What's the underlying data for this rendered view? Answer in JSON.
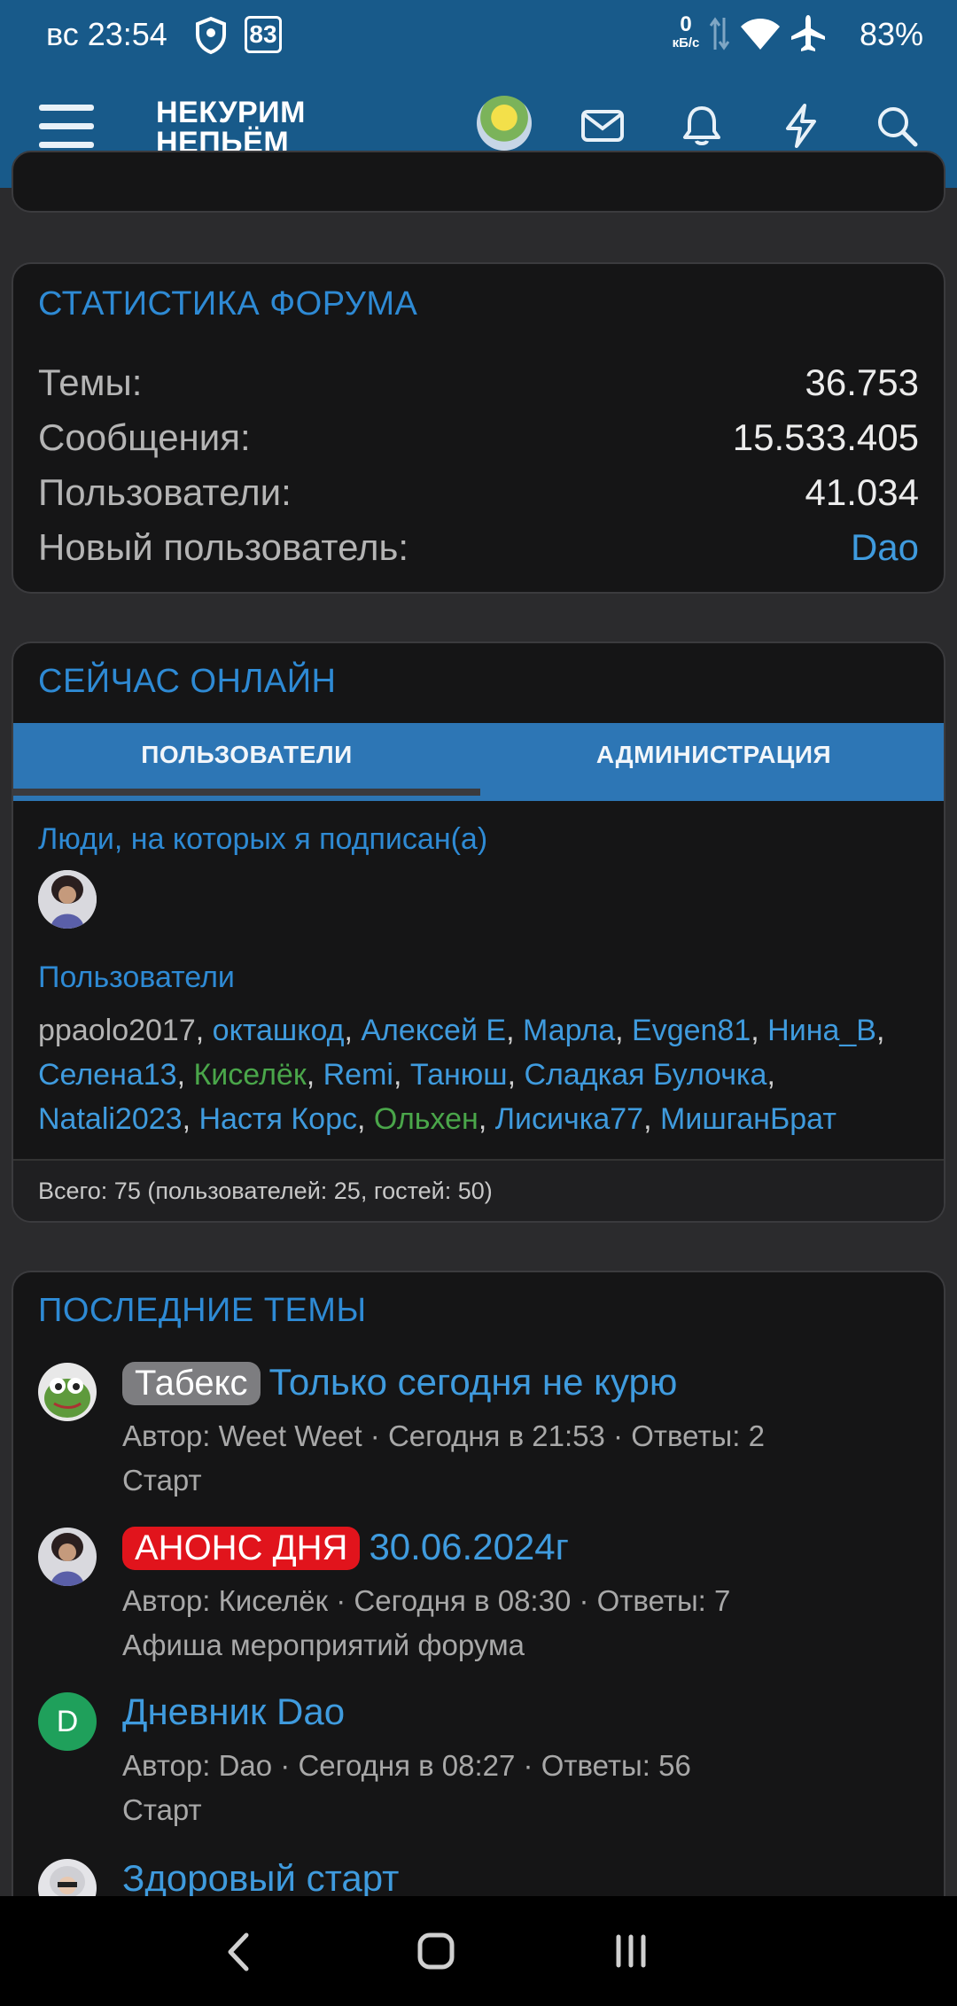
{
  "status_bar": {
    "time": "вс 23:54",
    "badge_number": "83",
    "net_speed_value": "0",
    "net_speed_unit": "кБ/с",
    "battery": "83%"
  },
  "app_bar": {
    "logo_line1": "НЕКУРИМ",
    "logo_line2": "НЕПЬЁМ"
  },
  "stats": {
    "title": "СТАТИСТИКА ФОРУМА",
    "rows": [
      {
        "label": "Темы:",
        "value": "36.753"
      },
      {
        "label": "Сообщения:",
        "value": "15.533.405"
      },
      {
        "label": "Пользователи:",
        "value": "41.034"
      },
      {
        "label": "Новый пользователь:",
        "value": "Dao"
      }
    ]
  },
  "online": {
    "title": "СЕЙЧАС ОНЛАЙН",
    "tabs": [
      "ПОЛЬЗОВАТЕЛИ",
      "АДМИНИСТРАЦИЯ"
    ],
    "following_heading": "Люди, на которых я подписан(а)",
    "users_heading": "Пользователи",
    "users": [
      {
        "name": "ppaolo2017",
        "color": "grey"
      },
      {
        "name": "окташкод",
        "color": "blue"
      },
      {
        "name": "Алексей Е",
        "color": "blue"
      },
      {
        "name": "Марла",
        "color": "blue"
      },
      {
        "name": "Evgen81",
        "color": "blue"
      },
      {
        "name": "Нина_В",
        "color": "blue"
      },
      {
        "name": "Селена13",
        "color": "blue"
      },
      {
        "name": "Киселёк",
        "color": "green"
      },
      {
        "name": "Remi",
        "color": "blue"
      },
      {
        "name": "Танюш",
        "color": "blue"
      },
      {
        "name": "Сладкая Булочка",
        "color": "blue"
      },
      {
        "name": "Natali2023",
        "color": "blue"
      },
      {
        "name": "Настя Корс",
        "color": "blue"
      },
      {
        "name": "Ольхен",
        "color": "green"
      },
      {
        "name": "Лисичка77",
        "color": "blue"
      },
      {
        "name": "МишганБрат",
        "color": "blue"
      }
    ],
    "total": "Всего: 75 (пользователей: 25, гостей: 50)"
  },
  "latest": {
    "title": "ПОСЛЕДНИЕ ТЕМЫ",
    "threads": [
      {
        "prefix": "Табекс",
        "prefix_color": "grey",
        "title": "Только сегодня не курю",
        "meta": "Автор: Weet Weet · Сегодня в 21:53 · Ответы: 2",
        "forum": "Старт"
      },
      {
        "prefix": "АНОНС ДНЯ",
        "prefix_color": "red",
        "title": "30.06.2024г",
        "meta": "Автор: Киселёк · Сегодня в 08:30 · Ответы: 7",
        "forum": "Афиша мероприятий форума"
      },
      {
        "prefix": "",
        "prefix_color": "",
        "title": "Дневник Dao",
        "meta": "Автор: Dao · Сегодня в 08:27 · Ответы: 56",
        "forum": "Старт",
        "avatar_letter": "D"
      },
      {
        "prefix": "",
        "prefix_color": "",
        "title": "Здоровый старт",
        "meta": "",
        "forum": ""
      }
    ]
  },
  "colors": {
    "header_bg": "#185a8a",
    "accent_blue": "#2e8ad4",
    "link_blue": "#3f9bde",
    "green_user": "#4aa64a",
    "label_red": "#e1141c"
  }
}
